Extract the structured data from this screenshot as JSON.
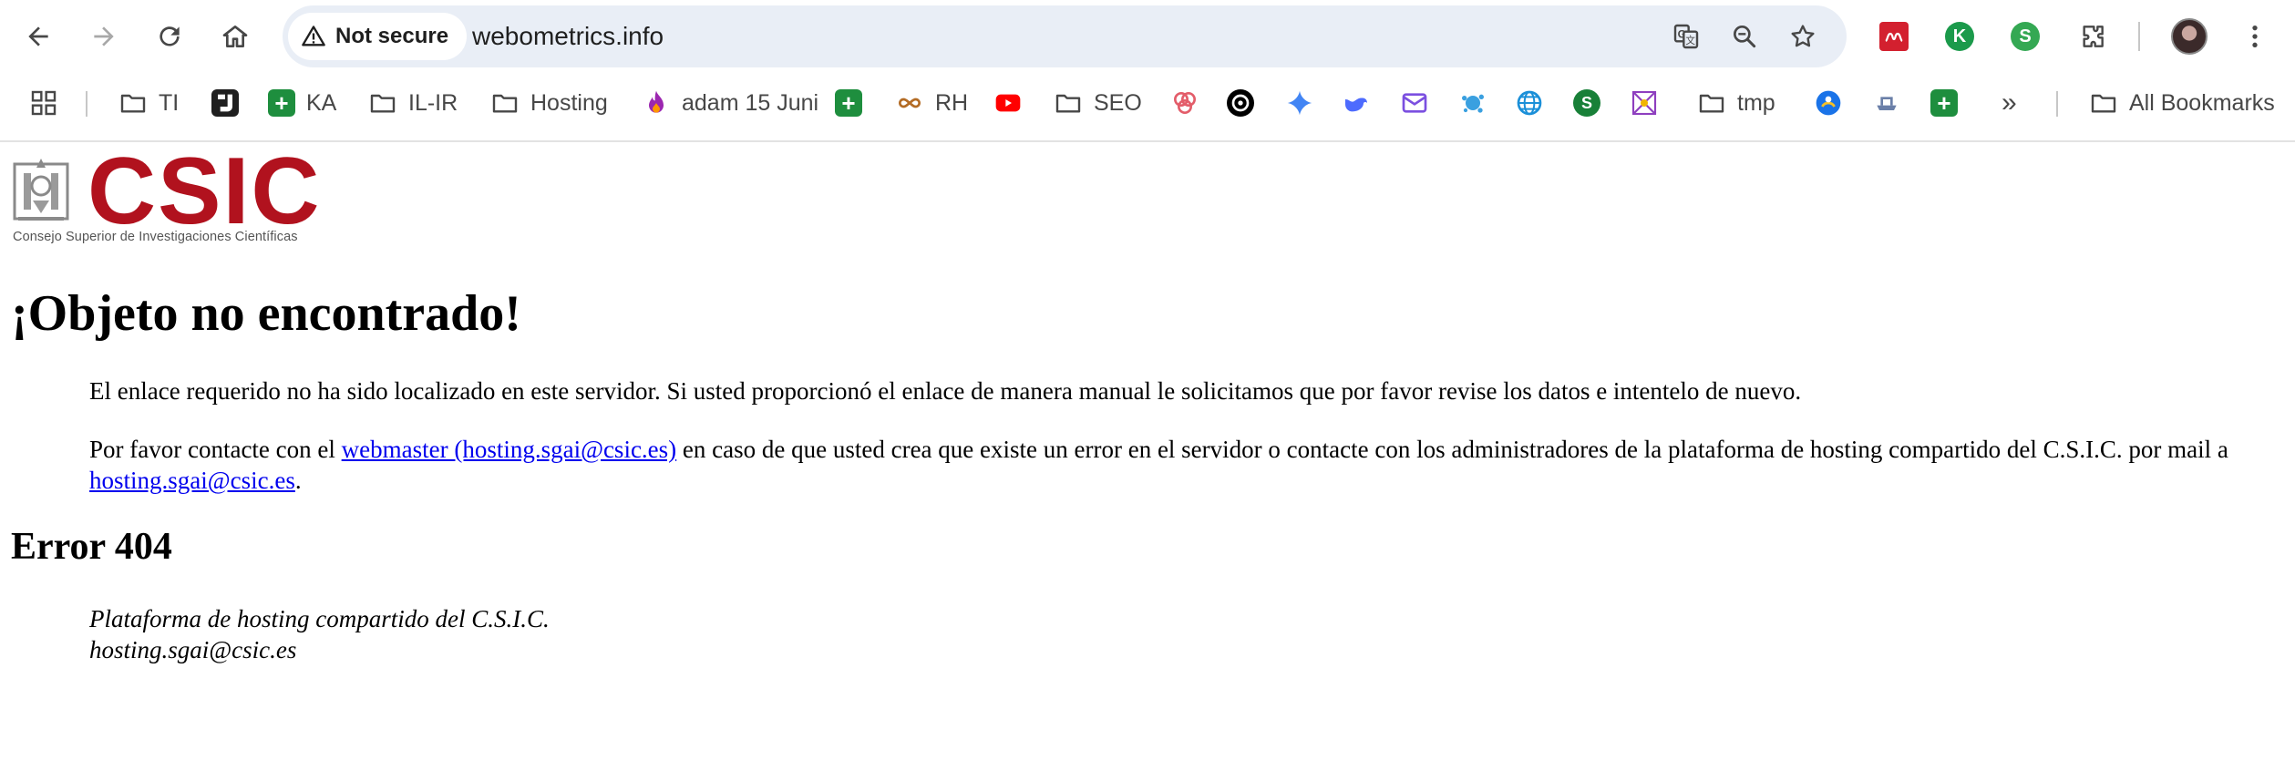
{
  "browser": {
    "security_label": "Not secure",
    "url": "webometrics.info",
    "icons": {
      "back": "arrow-left-icon",
      "forward": "arrow-right-icon",
      "reload": "reload-icon",
      "home": "home-icon",
      "translate": "translate-icon",
      "zoom": "magnifier-icon",
      "bookmark": "star-icon",
      "extensions": "puzzle-icon",
      "menu": "kebab-menu-icon"
    }
  },
  "bookmarks": {
    "items": [
      {
        "label": "TI",
        "type": "folder"
      },
      {
        "label": "",
        "type": "icon"
      },
      {
        "label": "KA",
        "type": "sheets"
      },
      {
        "label": "IL-IR",
        "type": "folder"
      },
      {
        "label": "Hosting",
        "type": "folder"
      },
      {
        "label": "adam 15 Juni",
        "type": "icon"
      },
      {
        "label": "",
        "type": "sheets"
      },
      {
        "label": "RH",
        "type": "icon"
      },
      {
        "label": "",
        "type": "youtube"
      },
      {
        "label": "SEO",
        "type": "folder"
      },
      {
        "label": "tmp",
        "type": "folder"
      }
    ],
    "overflow": "»",
    "all_bookmarks": "All Bookmarks"
  },
  "page": {
    "logo_text": "CSIC",
    "logo_subtitle": "Consejo Superior de Investigaciones Científicas",
    "heading": "¡Objeto no encontrado!",
    "paragraph1": "El enlace requerido no ha sido localizado en este servidor. Si usted proporcionó el enlace de manera manual le solicitamos que por favor revise los datos e intentelo de nuevo.",
    "paragraph2_prefix": "Por favor contacte con el ",
    "paragraph2_link": "webmaster (hosting.sgai@csic.es)",
    "paragraph2_middle": " en caso de que usted crea que existe un error en el servidor o contacte con los administradores de la plataforma de hosting compartido del C.S.I.C. por mail a ",
    "paragraph2_link2": "hosting.sgai@csic.es",
    "paragraph2_suffix": ".",
    "error_heading": "Error 404",
    "address_line1": "Plataforma de hosting compartido del C.S.I.C.",
    "address_line2": "hosting.sgai@csic.es"
  },
  "colors": {
    "logo_red": "#b1121e",
    "link_blue": "#0000ee",
    "omnibox_bg": "#e9eef6"
  }
}
